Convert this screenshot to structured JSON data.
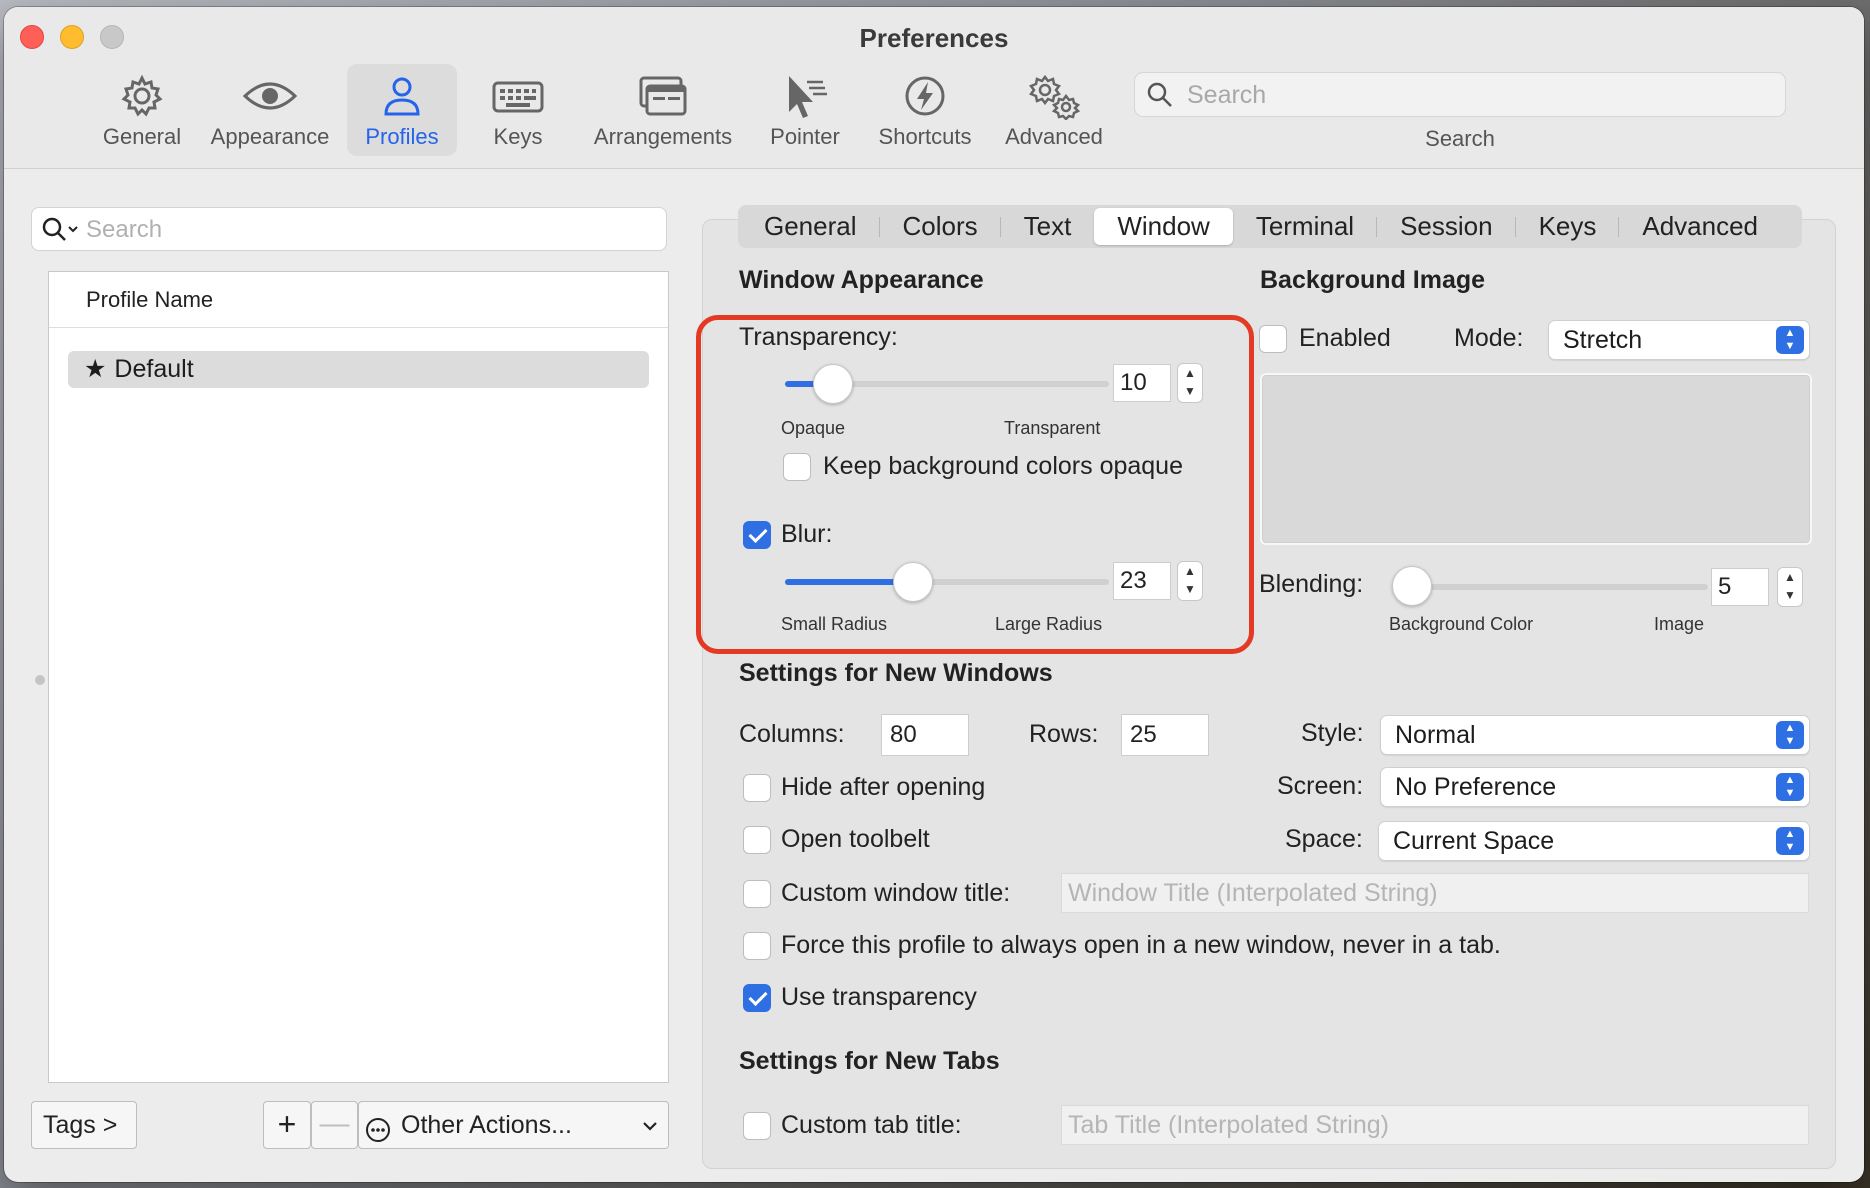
{
  "window": {
    "title": "Preferences"
  },
  "toolbar": {
    "items": [
      {
        "label": "General",
        "icon": "gear-icon"
      },
      {
        "label": "Appearance",
        "icon": "eye-icon"
      },
      {
        "label": "Profiles",
        "icon": "person-icon",
        "active": true
      },
      {
        "label": "Keys",
        "icon": "keyboard-icon"
      },
      {
        "label": "Arrangements",
        "icon": "windows-icon"
      },
      {
        "label": "Pointer",
        "icon": "pointer-icon"
      },
      {
        "label": "Shortcuts",
        "icon": "bolt-icon"
      },
      {
        "label": "Advanced",
        "icon": "gears-icon"
      }
    ],
    "search": {
      "placeholder": "Search",
      "caption": "Search"
    }
  },
  "sidebar": {
    "search_placeholder": "Search",
    "column_header": "Profile Name",
    "profiles": [
      {
        "name": "Default",
        "icon": "star-icon",
        "selected": true
      }
    ],
    "tags_button": "Tags >",
    "add_button": "+",
    "remove_button": "—",
    "other_actions": "Other Actions..."
  },
  "tabs": [
    "General",
    "Colors",
    "Text",
    "Window",
    "Terminal",
    "Session",
    "Keys",
    "Advanced"
  ],
  "active_tab": "Window",
  "window_appearance": {
    "title": "Window Appearance",
    "transparency": {
      "label": "Transparency:",
      "value": "10",
      "min_label": "Opaque",
      "max_label": "Transparent",
      "level": 0.1
    },
    "keep_opaque": {
      "label": "Keep background colors opaque",
      "checked": false
    },
    "blur": {
      "label": "Blur:",
      "checked": true,
      "value": "23",
      "min_label": "Small Radius",
      "max_label": "Large Radius",
      "level": 0.38
    }
  },
  "background_image": {
    "title": "Background Image",
    "enabled": {
      "label": "Enabled",
      "checked": false
    },
    "mode_label": "Mode:",
    "mode_value": "Stretch",
    "blending": {
      "label": "Blending:",
      "value": "5",
      "min_label": "Background Color",
      "max_label": "Image",
      "level": 0
    }
  },
  "new_windows": {
    "title": "Settings for New Windows",
    "columns_label": "Columns:",
    "columns_value": "80",
    "rows_label": "Rows:",
    "rows_value": "25",
    "style_label": "Style:",
    "style_value": "Normal",
    "screen_label": "Screen:",
    "screen_value": "No Preference",
    "space_label": "Space:",
    "space_value": "Current Space",
    "hide_after_opening": {
      "label": "Hide after opening",
      "checked": false
    },
    "open_toolbelt": {
      "label": "Open toolbelt",
      "checked": false
    },
    "custom_title": {
      "label": "Custom window title:",
      "checked": false,
      "placeholder": "Window Title (Interpolated String)"
    },
    "force_new_window": {
      "label": "Force this profile to always open in a new window, never in a tab.",
      "checked": false
    },
    "use_transparency": {
      "label": "Use transparency",
      "checked": true
    }
  },
  "new_tabs": {
    "title": "Settings for New Tabs",
    "custom_tab_title": {
      "label": "Custom tab title:",
      "checked": false,
      "placeholder": "Tab Title (Interpolated String)"
    }
  },
  "colors": {
    "accent": "#2f6fe4",
    "highlight_box": "#e43a24"
  }
}
